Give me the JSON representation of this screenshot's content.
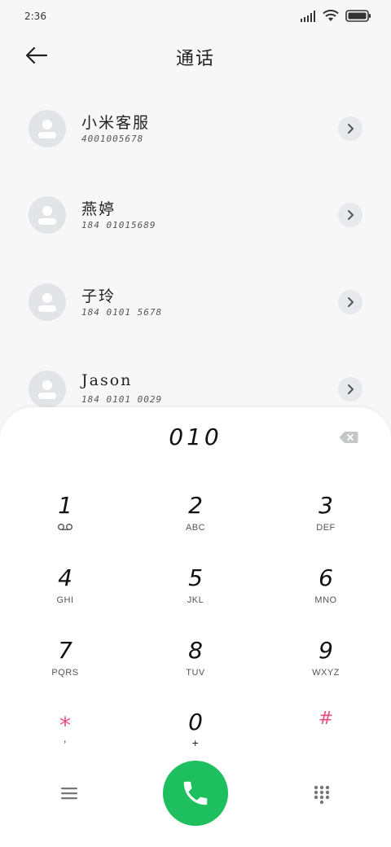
{
  "status_bar": {
    "time": "2:36",
    "icons": [
      "signal-icon",
      "wifi-icon",
      "battery-icon"
    ]
  },
  "header": {
    "title": "通话",
    "back_icon": "back-arrow-icon"
  },
  "contacts": [
    {
      "name": "小米客服",
      "number": "4001005678"
    },
    {
      "name": "燕婷",
      "number": "184 01015689"
    },
    {
      "name": "子玲",
      "number": "184 0101 5678"
    },
    {
      "name": "Jason",
      "number": "184 0101 0029"
    }
  ],
  "dialer": {
    "display": "010",
    "keys": [
      {
        "digit": "1",
        "letters": "voicemail-icon"
      },
      {
        "digit": "2",
        "letters": "ABC"
      },
      {
        "digit": "3",
        "letters": "DEF"
      },
      {
        "digit": "4",
        "letters": "GHI"
      },
      {
        "digit": "5",
        "letters": "JKL"
      },
      {
        "digit": "6",
        "letters": "MNO"
      },
      {
        "digit": "7",
        "letters": "PQRS"
      },
      {
        "digit": "8",
        "letters": "TUV"
      },
      {
        "digit": "9",
        "letters": "WXYZ"
      },
      {
        "digit": "*",
        "letters": ","
      },
      {
        "digit": "0",
        "letters": "+"
      },
      {
        "digit": "#",
        "letters": ""
      }
    ]
  },
  "colors": {
    "call_green": "#1dbf5f",
    "special_pink": "#e84b87",
    "avatar_gray": "#e3e4e8"
  }
}
